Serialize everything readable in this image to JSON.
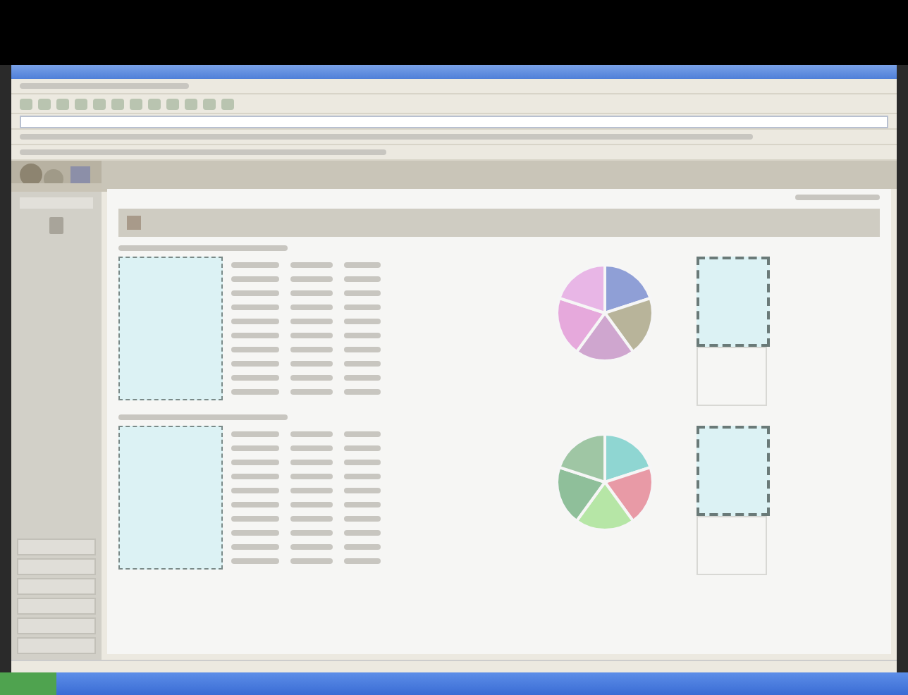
{
  "window": {
    "kind": "browser"
  },
  "nav_buttons": [
    {
      "kind": "button"
    },
    {
      "kind": "button"
    },
    {
      "kind": "button"
    },
    {
      "kind": "button"
    },
    {
      "kind": "button"
    },
    {
      "kind": "button"
    }
  ],
  "sections": [
    {
      "kind": "report",
      "rows": [
        {
          "kind": "data"
        },
        {
          "kind": "data"
        },
        {
          "kind": "data"
        },
        {
          "kind": "data"
        },
        {
          "kind": "data"
        },
        {
          "kind": "data"
        },
        {
          "kind": "data"
        },
        {
          "kind": "data"
        },
        {
          "kind": "data"
        },
        {
          "kind": "data"
        }
      ],
      "slices": [
        {
          "color": "#8f9fd6"
        },
        {
          "color": "#b8b49a"
        },
        {
          "color": "#cfa6cf"
        },
        {
          "color": "#e6a9dc"
        },
        {
          "color": "#e8b6e6"
        }
      ]
    },
    {
      "kind": "report",
      "rows": [
        {
          "kind": "data"
        },
        {
          "kind": "data"
        },
        {
          "kind": "data"
        },
        {
          "kind": "data"
        },
        {
          "kind": "data"
        },
        {
          "kind": "data"
        },
        {
          "kind": "data"
        },
        {
          "kind": "data"
        },
        {
          "kind": "data"
        },
        {
          "kind": "data"
        }
      ],
      "slices": [
        {
          "color": "#8fd6d2"
        },
        {
          "color": "#e89aa6"
        },
        {
          "color": "#b6e6a6"
        },
        {
          "color": "#8fbf9a"
        },
        {
          "color": "#9fc6a4"
        }
      ]
    }
  ]
}
